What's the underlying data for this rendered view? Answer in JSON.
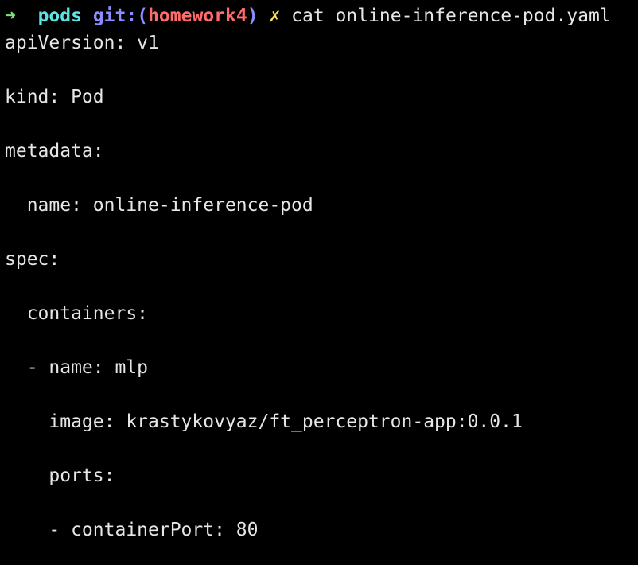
{
  "prompt": {
    "arrow": "➜",
    "directory": "pods",
    "git_label": "git:(",
    "branch": "homework4",
    "git_close": ")",
    "dirty_mark": "✗",
    "command": "cat online-inference-pod.yaml"
  },
  "output_lines": [
    "apiVersion: v1",
    "",
    "kind: Pod",
    "",
    "metadata:",
    "",
    "  name: online-inference-pod",
    "",
    "spec:",
    "",
    "  containers:",
    "",
    "  - name: mlp",
    "",
    "    image: krastykovyaz/ft_perceptron-app:0.0.1",
    "",
    "    ports:",
    "",
    "    - containerPort: 80"
  ],
  "colors": {
    "background": "#000000",
    "text": "#e6e6e6",
    "arrow": "#7ee57a",
    "directory": "#5fe3e3",
    "git": "#8a8cff",
    "branch": "#ff6b6b",
    "dirty": "#ffe14d"
  }
}
